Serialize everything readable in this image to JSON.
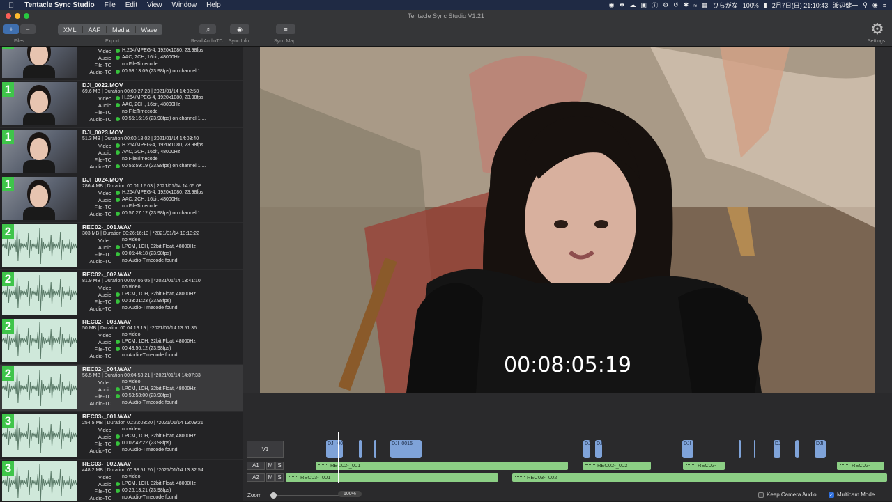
{
  "menubar": {
    "app_name": "Tentacle Sync Studio",
    "menus": [
      "File",
      "Edit",
      "View",
      "Window",
      "Help"
    ],
    "status": {
      "ime": "ひらがな",
      "battery": "100%",
      "datetime": "2月7日(日) 21:10:43",
      "user": "渡辺健一"
    }
  },
  "window": {
    "title": "Tentacle Sync Studio V1.21"
  },
  "toolbar": {
    "files_label": "Files",
    "add_label": "+",
    "remove_label": "−",
    "export_tabs": [
      "XML",
      "AAF",
      "Media",
      "Wave"
    ],
    "export_label": "Export",
    "read_audio_tc_label": "Read AudioTC",
    "sync_info_label": "Sync Info",
    "sync_map_label": "Sync Map",
    "settings_label": "Settings"
  },
  "files": [
    {
      "group": "1",
      "kind": "video",
      "name": "",
      "meta": "",
      "rows": [
        {
          "label": "Video",
          "value": "H.264/MPEG-4, 1920x1080, 23.98fps",
          "dot": true
        },
        {
          "label": "Audio",
          "value": "AAC, 2CH, 16bit, 48000Hz",
          "dot": true
        },
        {
          "label": "File-TC",
          "value": "no FileTimecode",
          "dot": false
        },
        {
          "label": "Audio-TC",
          "value": "00:53:13:09 (23.98fps) on channel 1 ...",
          "dot": true
        }
      ]
    },
    {
      "group": "1",
      "kind": "video",
      "name": "DJI_0022.MOV",
      "meta": "69.6 MB | Duration 00:00:27:23 | 2021/01/14 14:02:58",
      "rows": [
        {
          "label": "Video",
          "value": "H.264/MPEG-4, 1920x1080, 23.98fps",
          "dot": true
        },
        {
          "label": "Audio",
          "value": "AAC, 2CH, 16bit, 48000Hz",
          "dot": true
        },
        {
          "label": "File-TC",
          "value": "no FileTimecode",
          "dot": false
        },
        {
          "label": "Audio-TC",
          "value": "00:55:16:16 (23.98fps) on channel 1 ...",
          "dot": true
        }
      ]
    },
    {
      "group": "1",
      "kind": "video",
      "name": "DJI_0023.MOV",
      "meta": "51.3 MB | Duration 00:00:18:02 | 2021/01/14 14:03:40",
      "rows": [
        {
          "label": "Video",
          "value": "H.264/MPEG-4, 1920x1080, 23.98fps",
          "dot": true
        },
        {
          "label": "Audio",
          "value": "AAC, 2CH, 16bit, 48000Hz",
          "dot": true
        },
        {
          "label": "File-TC",
          "value": "no FileTimecode",
          "dot": false
        },
        {
          "label": "Audio-TC",
          "value": "00:55:59:19 (23.98fps) on channel 1 ...",
          "dot": true
        }
      ]
    },
    {
      "group": "1",
      "kind": "video",
      "name": "DJI_0024.MOV",
      "meta": "286.4 MB | Duration 00:01:12:03 | 2021/01/14 14:05:08",
      "rows": [
        {
          "label": "Video",
          "value": "H.264/MPEG-4, 1920x1080, 23.98fps",
          "dot": true
        },
        {
          "label": "Audio",
          "value": "AAC, 2CH, 16bit, 48000Hz",
          "dot": true
        },
        {
          "label": "File-TC",
          "value": "no FileTimecode",
          "dot": false
        },
        {
          "label": "Audio-TC",
          "value": "00:57:27:12 (23.98fps) on channel 1 ...",
          "dot": true
        }
      ]
    },
    {
      "group": "2",
      "kind": "audio",
      "name": "REC02-_001.WAV",
      "meta": "303 MB | Duration 00:26:16:13 | *2021/01/14 13:13:22",
      "rows": [
        {
          "label": "Video",
          "value": "no video",
          "dot": false
        },
        {
          "label": "Audio",
          "value": "LPCM, 1CH, 32bit Float, 48000Hz",
          "dot": true
        },
        {
          "label": "File-TC",
          "value": "00:05:44:18 (23.98fps)",
          "dot": true
        },
        {
          "label": "Audio-TC",
          "value": "no Audio-Timecode found",
          "dot": false
        }
      ]
    },
    {
      "group": "2",
      "kind": "audio",
      "name": "REC02-_002.WAV",
      "meta": "81.9 MB | Duration 00:07:06:05 | *2021/01/14 13:41:10",
      "rows": [
        {
          "label": "Video",
          "value": "no video",
          "dot": false
        },
        {
          "label": "Audio",
          "value": "LPCM, 1CH, 32bit Float, 48000Hz",
          "dot": true
        },
        {
          "label": "File-TC",
          "value": "00:33:31:23 (23.98fps)",
          "dot": true
        },
        {
          "label": "Audio-TC",
          "value": "no Audio-Timecode found",
          "dot": false
        }
      ]
    },
    {
      "group": "2",
      "kind": "audio",
      "name": "REC02-_003.WAV",
      "meta": "50 MB | Duration 00:04:19:19 | *2021/01/14 13:51:36",
      "rows": [
        {
          "label": "Video",
          "value": "no video",
          "dot": false
        },
        {
          "label": "Audio",
          "value": "LPCM, 1CH, 32bit Float, 48000Hz",
          "dot": true
        },
        {
          "label": "File-TC",
          "value": "00:43:56:12 (23.98fps)",
          "dot": true
        },
        {
          "label": "Audio-TC",
          "value": "no Audio-Timecode found",
          "dot": false
        }
      ]
    },
    {
      "group": "2",
      "kind": "audio",
      "name": "REC02-_004.WAV",
      "meta": "56.5 MB | Duration 00:04:53:21 | *2021/01/14 14:07:33",
      "selected": true,
      "rows": [
        {
          "label": "Video",
          "value": "no video",
          "dot": false
        },
        {
          "label": "Audio",
          "value": "LPCM, 1CH, 32bit Float, 48000Hz",
          "dot": true
        },
        {
          "label": "File-TC",
          "value": "00:59:53:00 (23.98fps)",
          "dot": true
        },
        {
          "label": "Audio-TC",
          "value": "no Audio-Timecode found",
          "dot": false
        }
      ]
    },
    {
      "group": "3",
      "kind": "audio",
      "name": "REC03-_001.WAV",
      "meta": "254.5 MB | Duration 00:22:03:20 | *2021/01/14 13:09:21",
      "rows": [
        {
          "label": "Video",
          "value": "no video",
          "dot": false
        },
        {
          "label": "Audio",
          "value": "LPCM, 1CH, 32bit Float, 48000Hz",
          "dot": true
        },
        {
          "label": "File-TC",
          "value": "00:02:42:22 (23.98fps)",
          "dot": true
        },
        {
          "label": "Audio-TC",
          "value": "no Audio-Timecode found",
          "dot": false
        }
      ]
    },
    {
      "group": "3",
      "kind": "audio",
      "name": "REC03-_002.WAV",
      "meta": "448.2 MB | Duration 00:38:51:20 | *2021/01/14 13:32:54",
      "rows": [
        {
          "label": "Video",
          "value": "no video",
          "dot": false
        },
        {
          "label": "Audio",
          "value": "LPCM, 1CH, 32bit Float, 48000Hz",
          "dot": true
        },
        {
          "label": "File-TC",
          "value": "00:26:13:21 (23.98fps)",
          "dot": true
        },
        {
          "label": "Audio-TC",
          "value": "no Audio-Timecode found",
          "dot": false
        }
      ]
    }
  ],
  "preview": {
    "timecode": "00:08:05:19"
  },
  "timeline": {
    "tracks": [
      "V1",
      "A1",
      "A2"
    ],
    "mute_label": "M",
    "solo_label": "S",
    "video_clips": [
      {
        "label": "DJI_0011"
      },
      {
        "label": ""
      },
      {
        "label": ""
      },
      {
        "label": "DJI_0015"
      },
      {
        "label": "DJ"
      },
      {
        "label": "DJ"
      },
      {
        "label": "DJI_0"
      },
      {
        "label": ""
      },
      {
        "label": ""
      },
      {
        "label": "DJ"
      },
      {
        "label": ""
      },
      {
        "label": "DJI_0"
      }
    ],
    "a1_clips": [
      "REC02-_001",
      "REC02-_002",
      "REC02-",
      "REC02-"
    ],
    "a2_clips": [
      "REC03-_001",
      "REC03-_002"
    ]
  },
  "zoombar": {
    "zoom_label": "Zoom",
    "zoom_value": "100%",
    "keep_camera_audio": "Keep Camera Audio",
    "multicam_mode": "Multicam Mode",
    "keep_camera_audio_checked": false,
    "multicam_checked": true
  }
}
